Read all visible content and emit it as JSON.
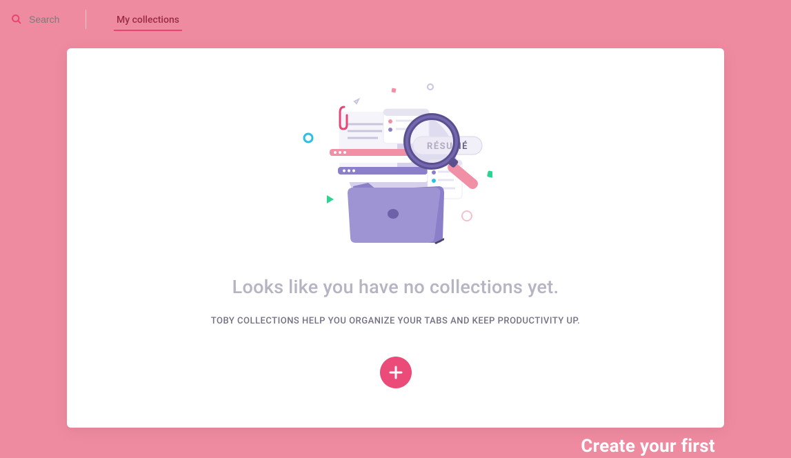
{
  "header": {
    "search_placeholder": "Search",
    "tabs": [
      {
        "label": "My collections"
      }
    ]
  },
  "empty_state": {
    "illustration_label": "RÉSUMÉ",
    "title": "Looks like you have no collections yet.",
    "subtitle": "TOBY COLLECTIONS HELP YOU ORGANIZE YOUR TABS AND KEEP PRODUCTIVITY UP."
  },
  "footer": {
    "hint_text": "Create your first"
  },
  "colors": {
    "background": "#ef8ba0",
    "accent": "#ea4b78",
    "muted_text": "#b5b4c3"
  }
}
